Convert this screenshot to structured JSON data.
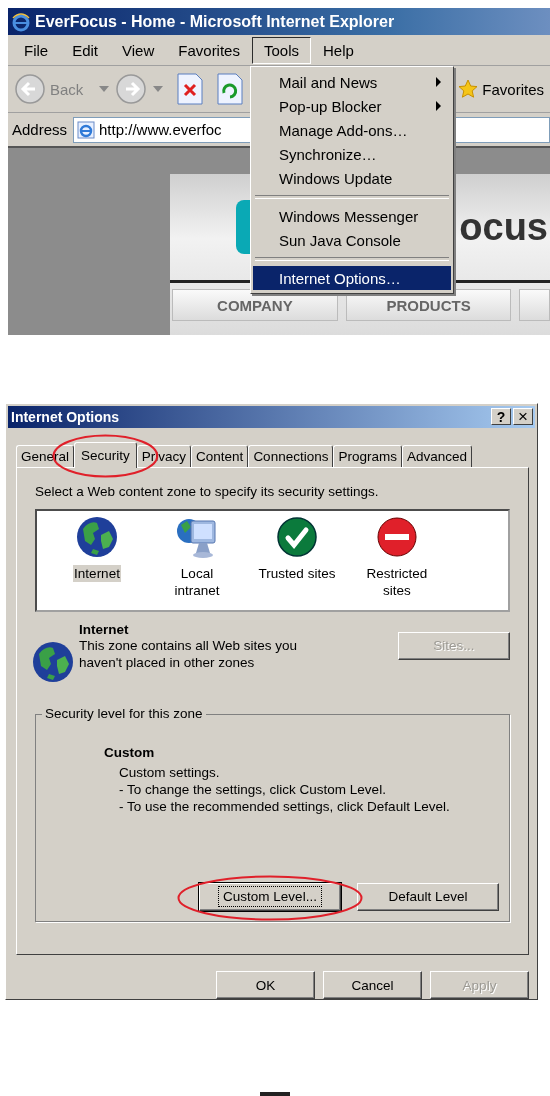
{
  "browser": {
    "title": "EverFocus - Home - Microsoft Internet Explorer",
    "menu_bar": [
      {
        "label": "File",
        "selected": false
      },
      {
        "label": "Edit",
        "selected": false
      },
      {
        "label": "View",
        "selected": false
      },
      {
        "label": "Favorites",
        "selected": false
      },
      {
        "label": "Tools",
        "selected": true
      },
      {
        "label": "Help",
        "selected": false
      }
    ],
    "toolbar": {
      "back": "Back",
      "favorites": "Favorites"
    },
    "address": {
      "label": "Address",
      "value": "http://www.everfoc"
    },
    "web_page": {
      "logo_text": "ocus",
      "nav": [
        "COMPANY",
        "PRODUCTS"
      ]
    },
    "tools_menu": [
      {
        "kind": "item",
        "label": "Mail and News",
        "submenu": true,
        "selected": false
      },
      {
        "kind": "item",
        "label": "Pop-up Blocker",
        "submenu": true,
        "selected": false
      },
      {
        "kind": "item",
        "label": "Manage Add-ons…",
        "submenu": false,
        "selected": false
      },
      {
        "kind": "item",
        "label": "Synchronize…",
        "submenu": false,
        "selected": false
      },
      {
        "kind": "item",
        "label": "Windows Update",
        "submenu": false,
        "selected": false
      },
      {
        "kind": "separator"
      },
      {
        "kind": "item",
        "label": "Windows Messenger",
        "submenu": false,
        "selected": false
      },
      {
        "kind": "item",
        "label": "Sun Java Console",
        "submenu": false,
        "selected": false
      },
      {
        "kind": "separator"
      },
      {
        "kind": "item",
        "label": "Internet Options…",
        "submenu": false,
        "selected": true
      }
    ]
  },
  "dialog": {
    "title": "Internet Options",
    "title_buttons": [
      {
        "kind": "help",
        "label": "?"
      },
      {
        "kind": "close",
        "label": "×"
      }
    ],
    "tabs": [
      {
        "label": "General",
        "selected": false,
        "circled": false
      },
      {
        "label": "Security",
        "selected": true,
        "circled": true
      },
      {
        "label": "Privacy",
        "selected": false,
        "circled": false
      },
      {
        "label": "Content",
        "selected": false,
        "circled": false
      },
      {
        "label": "Connections",
        "selected": false,
        "circled": false
      },
      {
        "label": "Programs",
        "selected": false,
        "circled": false
      },
      {
        "label": "Advanced",
        "selected": false,
        "circled": false
      }
    ],
    "instruction": "Select a Web content zone to specify its security settings.",
    "zones": [
      {
        "kind": "internet",
        "label": "Internet",
        "selected": true
      },
      {
        "kind": "intranet",
        "label": "Local intranet",
        "selected": false
      },
      {
        "kind": "trusted",
        "label": "Trusted sites",
        "selected": false
      },
      {
        "kind": "restricted",
        "label": "Restricted sites",
        "selected": false
      }
    ],
    "zone_info": {
      "title": "Internet",
      "description": "This zone contains all Web sites you haven't placed in other zones",
      "sites_button": {
        "label": "Sites...",
        "disabled": true
      }
    },
    "security_level": {
      "legend": "Security level for this zone",
      "level_name": "Custom",
      "lines": [
        "Custom settings.",
        "- To change the settings, click Custom Level.",
        "- To use the recommended settings, click Default Level."
      ],
      "buttons": [
        {
          "label": "Custom Level...",
          "focused": true,
          "circled": true
        },
        {
          "label": "Default Level",
          "focused": false,
          "circled": false
        }
      ]
    },
    "buttons": [
      {
        "label": "OK",
        "disabled": false
      },
      {
        "label": "Cancel",
        "disabled": false
      },
      {
        "label": "Apply",
        "disabled": true
      }
    ]
  }
}
